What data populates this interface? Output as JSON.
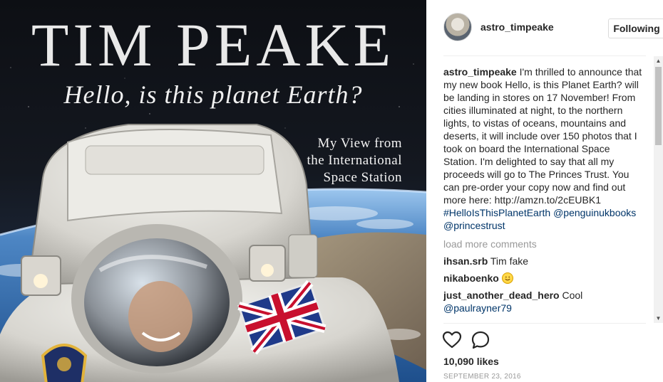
{
  "cover": {
    "title": "TIM PEAKE",
    "subtitle": "Hello, is this planet Earth?",
    "tagline_lines": [
      "My View from",
      "the International",
      "Space Station"
    ]
  },
  "post": {
    "username": "astro_timpeake",
    "follow_button_label": "Following",
    "caption": {
      "username": "astro_timpeake",
      "text": "I'm thrilled to announce that my new book Hello, is this Planet Earth? will be landing in stores on 17 November! From cities illuminated at night, to the northern lights, to vistas of oceans, mountains and deserts, it will include over 150 photos that I took on board the International Space Station. I'm delighted to say that all my proceeds will go to The Princes Trust. You can pre-order your copy now and find out more here:",
      "link": "http://amzn.to/2cEUBK1",
      "hashtag": "#HelloIsThisPlanetEarth",
      "mention_1": "@penguinukbooks",
      "mention_2": "@princestrust"
    },
    "load_more_label": "load more comments",
    "comments": [
      {
        "username": "ihsan.srb",
        "text": "Tim fake"
      },
      {
        "username": "nikaboenko",
        "text": "",
        "emoji": "smiling-face-emoji"
      },
      {
        "username": "just_another_dead_hero",
        "text": "Cool",
        "mention": "@paulrayner79"
      }
    ],
    "likes": "10,090 likes",
    "date": "SEPTEMBER 23, 2016"
  },
  "icons": {
    "like": "heart-icon",
    "comment": "comment-icon",
    "scroll_up": "scroll-up-arrow-icon",
    "scroll_down": "scroll-down-arrow-icon"
  },
  "colors": {
    "text": "#262626",
    "muted": "#999999",
    "link": "#003569",
    "border": "#dbdbdb"
  }
}
